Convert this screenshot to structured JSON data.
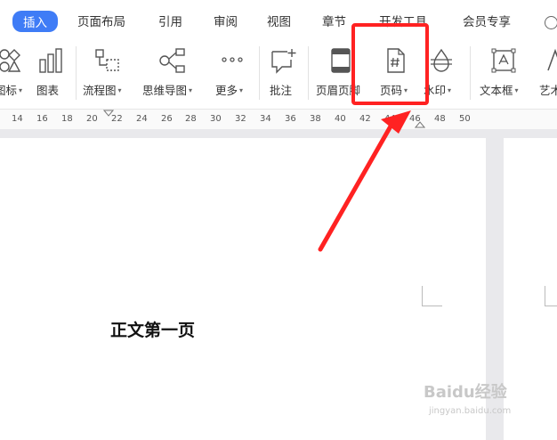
{
  "tabs": [
    {
      "label": "插入",
      "active": true
    },
    {
      "label": "页面布局"
    },
    {
      "label": "引用"
    },
    {
      "label": "审阅"
    },
    {
      "label": "视图"
    },
    {
      "label": "章节"
    },
    {
      "label": "开发工具"
    },
    {
      "label": "会员专享"
    }
  ],
  "ribbon": {
    "icons_label": "图标",
    "chart_label": "图表",
    "flowchart_label": "流程图",
    "mindmap_label": "思维导图",
    "more_label": "更多",
    "comment_label": "批注",
    "header_footer_label": "页眉页脚",
    "page_number_label": "页码",
    "watermark_label": "水印",
    "textbox_label": "文本框",
    "wordart_label": "艺术"
  },
  "ruler_ticks": [
    "14",
    "16",
    "18",
    "20",
    "22",
    "24",
    "26",
    "28",
    "30",
    "32",
    "34",
    "36",
    "38",
    "40",
    "42",
    "44",
    "46",
    "48",
    "50"
  ],
  "document": {
    "text": "正文第一页"
  },
  "watermark": {
    "brand": "Baidu经验",
    "url": "jingyan.baidu.com"
  },
  "colors": {
    "accent": "#3f7cf6",
    "annotation": "#ff2222"
  }
}
